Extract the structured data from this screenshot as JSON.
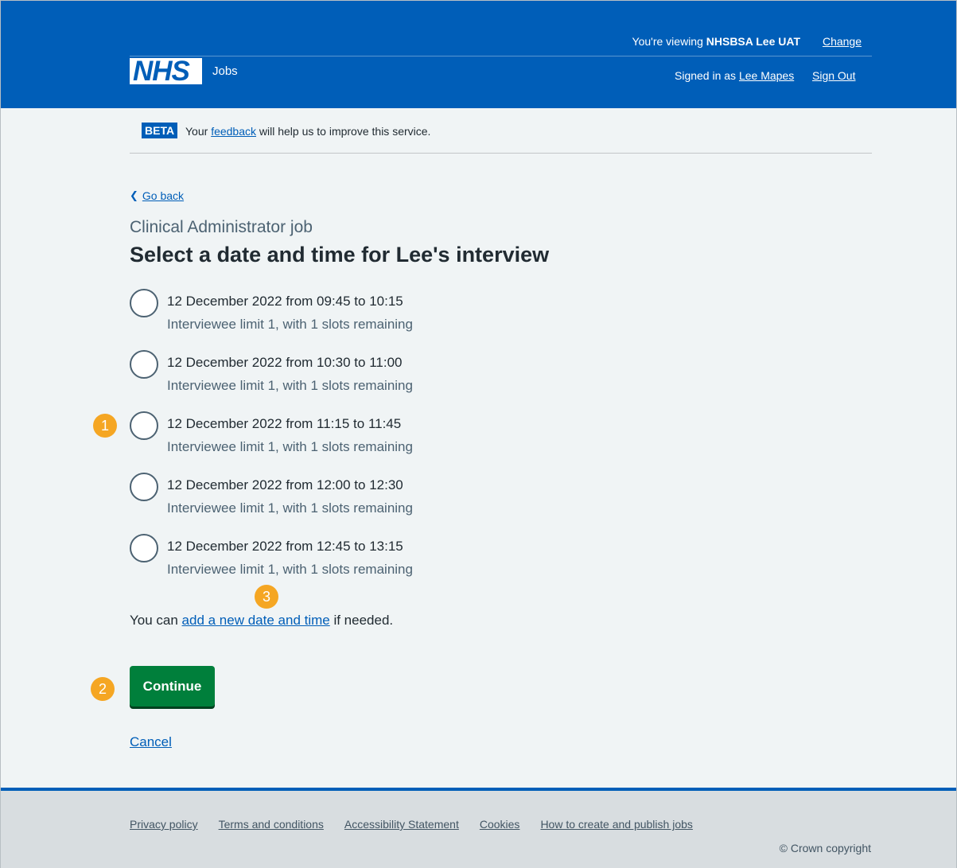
{
  "header": {
    "viewing_prefix": "You're viewing ",
    "viewing_org": "NHSBSA Lee UAT",
    "change_label": "Change",
    "logo_text": "NHS",
    "service_name": "Jobs",
    "signed_in_prefix": "Signed in as ",
    "user_name": "Lee Mapes",
    "sign_out_label": "Sign Out",
    "brand_color": "#005eb8"
  },
  "beta_banner": {
    "tag": "BETA",
    "text_before": "Your ",
    "link": "feedback",
    "text_after": " will help us to improve this service."
  },
  "main": {
    "back_label": "Go back",
    "caption": "Clinical Administrator job",
    "title": "Select a date and time for Lee's interview",
    "options": [
      {
        "label": "12 December 2022 from 09:45 to 10:15",
        "hint": "Interviewee limit 1, with 1 slots remaining"
      },
      {
        "label": "12 December 2022 from 10:30 to 11:00",
        "hint": "Interviewee limit 1, with 1 slots remaining"
      },
      {
        "label": "12 December 2022 from 11:15 to 11:45",
        "hint": "Interviewee limit 1, with 1 slots remaining"
      },
      {
        "label": "12 December 2022 from 12:00 to 12:30",
        "hint": "Interviewee limit 1, with 1 slots remaining"
      },
      {
        "label": "12 December 2022 from 12:45 to 13:15",
        "hint": "Interviewee limit 1, with 1 slots remaining"
      }
    ],
    "add_prefix": "You can ",
    "add_link": "add a new date and time",
    "add_suffix": " if needed.",
    "continue_label": "Continue",
    "cancel_label": "Cancel"
  },
  "markers": [
    "1",
    "2",
    "3"
  ],
  "footer": {
    "links": [
      "Privacy policy",
      "Terms and conditions",
      "Accessibility Statement",
      "Cookies",
      "How to create and publish jobs"
    ],
    "copyright": "© Crown copyright"
  }
}
